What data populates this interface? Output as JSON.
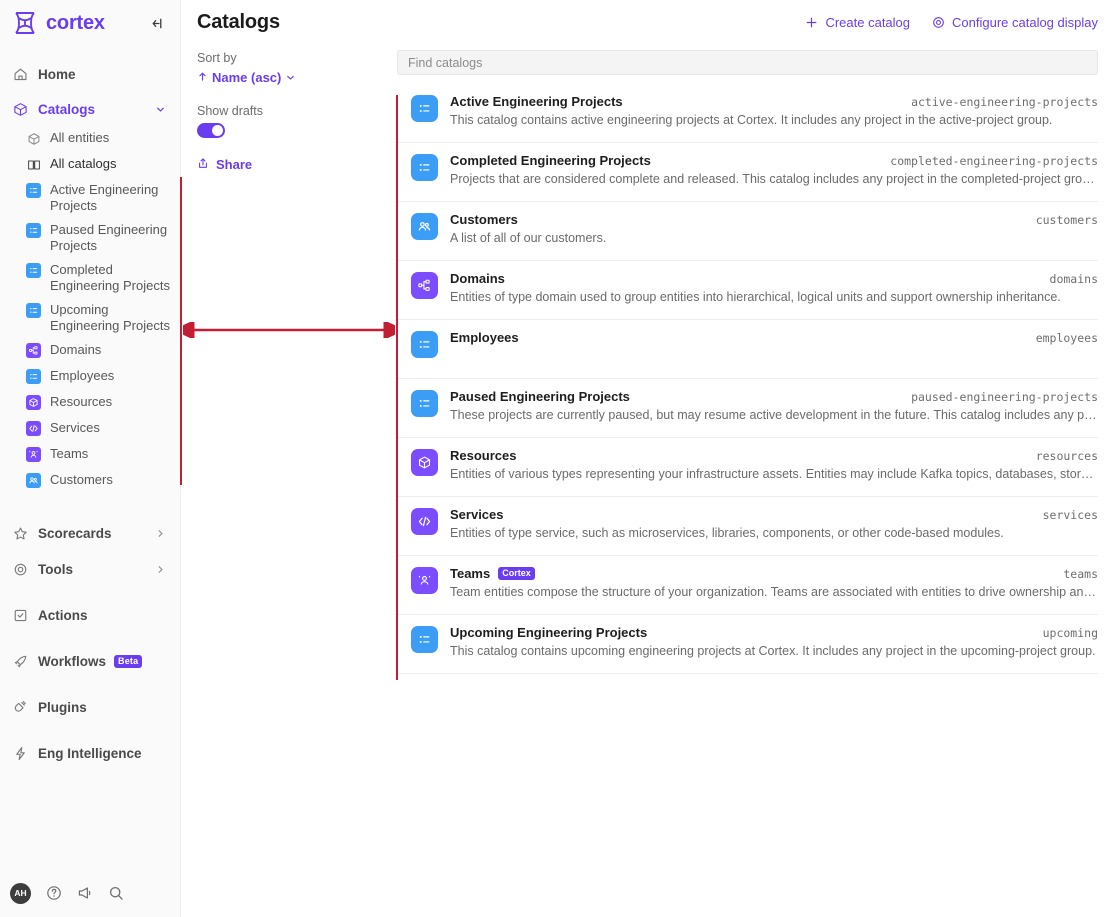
{
  "brand": {
    "name": "cortex",
    "logo_icon": "cortex-logo-icon",
    "collapse_icon": "collapse-sidebar-icon"
  },
  "sidebar": {
    "primary": [
      {
        "label": "Home",
        "icon": "home-icon",
        "active": false,
        "chevron": null
      },
      {
        "label": "Catalogs",
        "icon": "cube-icon",
        "active": true,
        "chevron": "chevron-down"
      }
    ],
    "catalog_children": [
      {
        "label": "All entities",
        "icon": "cube-outline-icon",
        "style": "plain"
      },
      {
        "label": "All catalogs",
        "icon": "book-open-icon",
        "style": "plain"
      },
      {
        "label": "Active Engineering Projects",
        "icon": "list-icon",
        "style": "blue"
      },
      {
        "label": "Paused Engineering Projects",
        "icon": "list-icon",
        "style": "blue"
      },
      {
        "label": "Completed Engineering Projects",
        "icon": "list-icon",
        "style": "blue"
      },
      {
        "label": "Upcoming Engineering Projects",
        "icon": "list-icon",
        "style": "blue"
      },
      {
        "label": "Domains",
        "icon": "domain-icon",
        "style": "purple"
      },
      {
        "label": "Employees",
        "icon": "list-icon",
        "style": "blue"
      },
      {
        "label": "Resources",
        "icon": "resource-cube-icon",
        "style": "purple"
      },
      {
        "label": "Services",
        "icon": "code-brackets-icon",
        "style": "purple"
      },
      {
        "label": "Teams",
        "icon": "team-icon",
        "style": "purple"
      },
      {
        "label": "Customers",
        "icon": "customers-icon",
        "style": "blue"
      }
    ],
    "secondary": [
      {
        "label": "Scorecards",
        "icon": "star-icon",
        "chevron": "chevron-right",
        "badge": null
      },
      {
        "label": "Tools",
        "icon": "gear-circle-icon",
        "chevron": "chevron-right",
        "badge": null
      },
      {
        "label": "Actions",
        "icon": "actions-icon",
        "chevron": null,
        "badge": null
      },
      {
        "label": "Workflows",
        "icon": "rocket-icon",
        "chevron": null,
        "badge": "Beta"
      },
      {
        "label": "Plugins",
        "icon": "plug-icon",
        "chevron": null,
        "badge": null
      },
      {
        "label": "Eng Intelligence",
        "icon": "lightning-icon",
        "chevron": null,
        "badge": null
      }
    ],
    "footer": {
      "avatar_initials": "AH",
      "icons": [
        "help-circle-icon",
        "megaphone-icon",
        "search-icon"
      ]
    }
  },
  "header": {
    "title": "Catalogs",
    "create_catalog_label": "Create catalog",
    "configure_label": "Configure catalog display"
  },
  "left_pane": {
    "sort_by_label": "Sort by",
    "sort_value": "Name (asc)",
    "show_drafts_label": "Show drafts",
    "show_drafts_on": true,
    "share_label": "Share"
  },
  "search": {
    "placeholder": "Find catalogs",
    "value": ""
  },
  "catalogs": [
    {
      "name": "Active Engineering Projects",
      "key": "active-engineering-projects",
      "description": "This catalog contains active engineering projects at Cortex. It includes any project in the active-project group.",
      "icon": "list-icon",
      "color": "blue",
      "tag": null
    },
    {
      "name": "Completed Engineering Projects",
      "key": "completed-engineering-projects",
      "description": "Projects that are considered complete and released. This catalog includes any project in the completed-project group.",
      "icon": "list-icon",
      "color": "blue",
      "tag": null
    },
    {
      "name": "Customers",
      "key": "customers",
      "description": "A list of all of our customers.",
      "icon": "customers-icon",
      "color": "blue",
      "tag": null
    },
    {
      "name": "Domains",
      "key": "domains",
      "description": "Entities of type domain used to group entities into hierarchical, logical units and support ownership inheritance.",
      "icon": "domain-icon",
      "color": "purple",
      "tag": null
    },
    {
      "name": "Employees",
      "key": "employees",
      "description": "",
      "icon": "list-icon",
      "color": "blue",
      "tag": null
    },
    {
      "name": "Paused Engineering Projects",
      "key": "paused-engineering-projects",
      "description": "These projects are currently paused, but may resume active development in the future. This catalog includes any project in the …",
      "icon": "list-icon",
      "color": "blue",
      "tag": null
    },
    {
      "name": "Resources",
      "key": "resources",
      "description": "Entities of various types representing your infrastructure assets. Entities may include Kafka topics, databases, storage, custom …",
      "icon": "resource-cube-icon",
      "color": "purple",
      "tag": null
    },
    {
      "name": "Services",
      "key": "services",
      "description": "Entities of type service, such as microservices, libraries, components, or other code-based modules.",
      "icon": "code-brackets-icon",
      "color": "purple",
      "tag": null
    },
    {
      "name": "Teams",
      "key": "teams",
      "description": "Team entities compose the structure of your organization. Teams are associated with entities to drive ownership and power man…",
      "icon": "team-icon",
      "color": "purple",
      "tag": "Cortex"
    },
    {
      "name": "Upcoming Engineering Projects",
      "key": "upcoming",
      "description": "This catalog contains upcoming engineering projects at Cortex. It includes any project in the upcoming-project group.",
      "icon": "list-icon",
      "color": "blue",
      "tag": null
    }
  ],
  "annotation": {
    "type": "width-measure-arrow",
    "color": "#c21f35"
  },
  "colors": {
    "accent": "#6b3df0",
    "icon_blue": "#3b9df5",
    "icon_purple": "#7c4dff",
    "annotation_red": "#c21f35"
  }
}
